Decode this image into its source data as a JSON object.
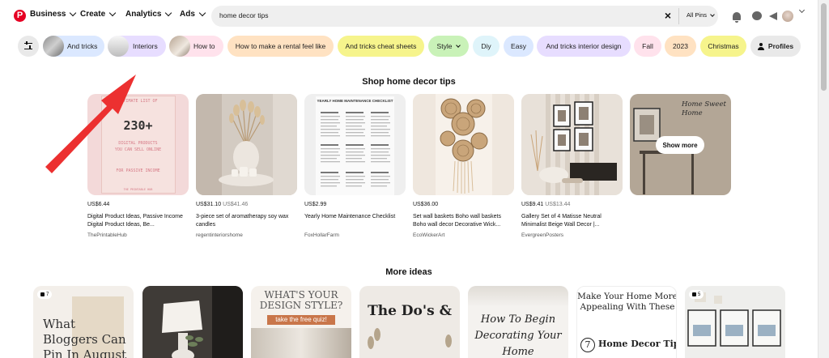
{
  "nav": {
    "logo": "P",
    "business": "Business",
    "create": "Create",
    "analytics": "Analytics",
    "ads": "Ads"
  },
  "search": {
    "query": "home decor tips",
    "clear": "×",
    "filter": "All Pins"
  },
  "chips": [
    {
      "label": "And tricks",
      "color": "#dbe8ff"
    },
    {
      "label": "Interiors",
      "color": "#e7ddff"
    },
    {
      "label": "How to",
      "color": "#ffe2ec"
    },
    {
      "label": "How to make a rental feel like",
      "color": "#ffe2c2"
    },
    {
      "label": "And tricks cheat sheets",
      "color": "#f6f48c"
    },
    {
      "label": "Style",
      "color": "#c9f2b8"
    },
    {
      "label": "Diy",
      "color": "#dff4fa"
    },
    {
      "label": "Easy",
      "color": "#dbe8ff"
    },
    {
      "label": "And tricks interior design",
      "color": "#e7ddff"
    },
    {
      "label": "Fall",
      "color": "#ffe2ec"
    },
    {
      "label": "2023",
      "color": "#ffe2c2"
    },
    {
      "label": "Christmas",
      "color": "#f6f48c"
    },
    {
      "label": "Profiles",
      "color": "#e9e9e9"
    }
  ],
  "shop": {
    "title": "Shop home decor tips",
    "show_more": "Show more",
    "products": [
      {
        "price": "US$6.44",
        "orig": "",
        "title": "Digital Product Ideas, Passive Income Digital Product Ideas, Be...",
        "seller": "ThePrintableHub",
        "img_text": {
          "l1": "ULTIMATE LIST OF",
          "l2": "230+",
          "l3": "DIGITAL PRODUCTS",
          "l4": "YOU CAN SELL ONLINE",
          "l5": "FOR PASSIVE INCOME",
          "l6": "THE PRINTABLE HUB"
        }
      },
      {
        "price": "US$31.10",
        "orig": "US$41.46",
        "title": "3-piece set of aromatherapy soy wax candles",
        "seller": "regentinteriorshome"
      },
      {
        "price": "US$2.99",
        "orig": "",
        "title": "Yearly Home Maintenance Checklist",
        "seller": "FoxHollarFarm",
        "img_text": {
          "l1": "YEARLY HOME MAINTENANCE CHECKLIST"
        }
      },
      {
        "price": "US$36.00",
        "orig": "",
        "title": "Set wall baskets Boho wall baskets Boho wall decor Decorative Wick...",
        "seller": "EcoWickerArt"
      },
      {
        "price": "US$9.41",
        "orig": "US$13.44",
        "title": "Gallery Set of 4 Matisse Neutral Minimalist Beige Wall Decor |...",
        "seller": "EvergreenPosters"
      }
    ],
    "more_tile_text": "Home Sweet Home"
  },
  "more_ideas": {
    "title": "More ideas",
    "pins": [
      {
        "badge": "7",
        "text": "What Bloggers Can Pin In August"
      },
      {
        "badge": "",
        "text": ""
      },
      {
        "badge": "",
        "text": "WHAT'S YOUR DESIGN STYLE?",
        "sub": "take the free quiz!"
      },
      {
        "badge": "",
        "text": "The Do's &"
      },
      {
        "badge": "",
        "text": "How To Begin Decorating Your Home"
      },
      {
        "badge": "",
        "text": "Make Your Home More Appealing With These",
        "sub": "Home Decor Tips",
        "num": "7"
      },
      {
        "badge": "5",
        "text": ""
      }
    ]
  }
}
